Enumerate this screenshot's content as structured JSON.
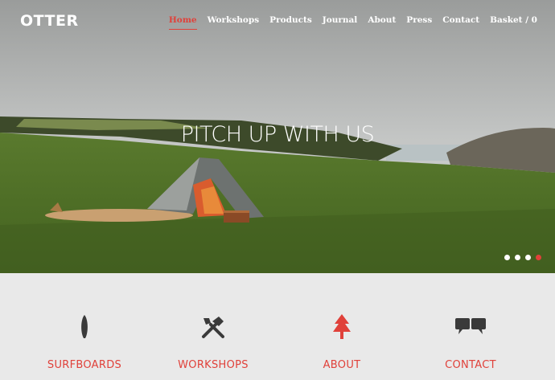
{
  "brand": {
    "logo_text": "OTTER"
  },
  "nav": {
    "items": [
      {
        "label": "Home",
        "active": true
      },
      {
        "label": "Workshops",
        "active": false
      },
      {
        "label": "Products",
        "active": false
      },
      {
        "label": "Journal",
        "active": false
      },
      {
        "label": "About",
        "active": false
      },
      {
        "label": "Press",
        "active": false
      },
      {
        "label": "Contact",
        "active": false
      },
      {
        "label": "Basket / 0",
        "active": false
      }
    ]
  },
  "hero": {
    "headline": "PITCH UP WITH US",
    "image": "tent-and-surfboard-on-clifftop-field",
    "slides": {
      "count": 4,
      "active_index": 3
    }
  },
  "features": [
    {
      "label": "SURFBOARDS",
      "icon": "surfboard-icon"
    },
    {
      "label": "WORKSHOPS",
      "icon": "tools-icon"
    },
    {
      "label": "ABOUT",
      "icon": "tree-icon"
    },
    {
      "label": "CONTACT",
      "icon": "speech-bubbles-icon"
    }
  ],
  "colors": {
    "accent": "#e0413a",
    "icon_dark": "#3a3a3a",
    "band_bg": "#e9e9e9"
  }
}
